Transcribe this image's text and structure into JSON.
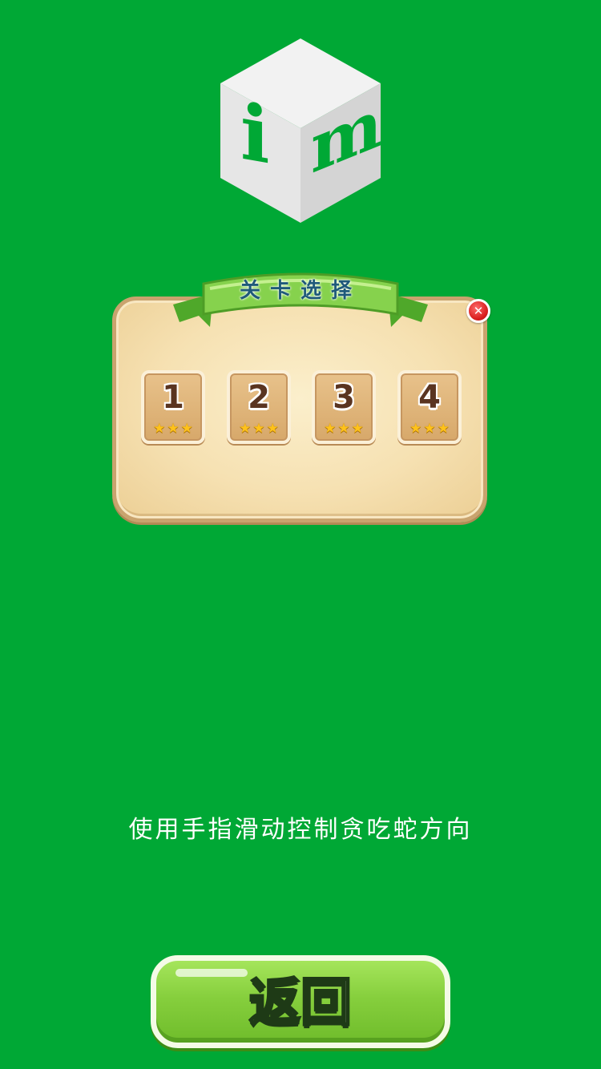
{
  "logo": {
    "letters": [
      "i",
      "m"
    ],
    "color": "#00a835"
  },
  "level_select": {
    "title": "关卡选择",
    "close_icon": "close-icon",
    "levels": [
      {
        "number": "1",
        "stars": 3
      },
      {
        "number": "2",
        "stars": 3
      },
      {
        "number": "3",
        "stars": 3
      },
      {
        "number": "4",
        "stars": 3
      }
    ]
  },
  "hint": "使用手指滑动控制贪吃蛇方向",
  "back_button": {
    "label": "返回"
  },
  "colors": {
    "background": "#00a835",
    "panel": "#f6e1b2",
    "ribbon": "#7fcf4a",
    "star": "#ffc21a",
    "close": "#d81d1d"
  }
}
